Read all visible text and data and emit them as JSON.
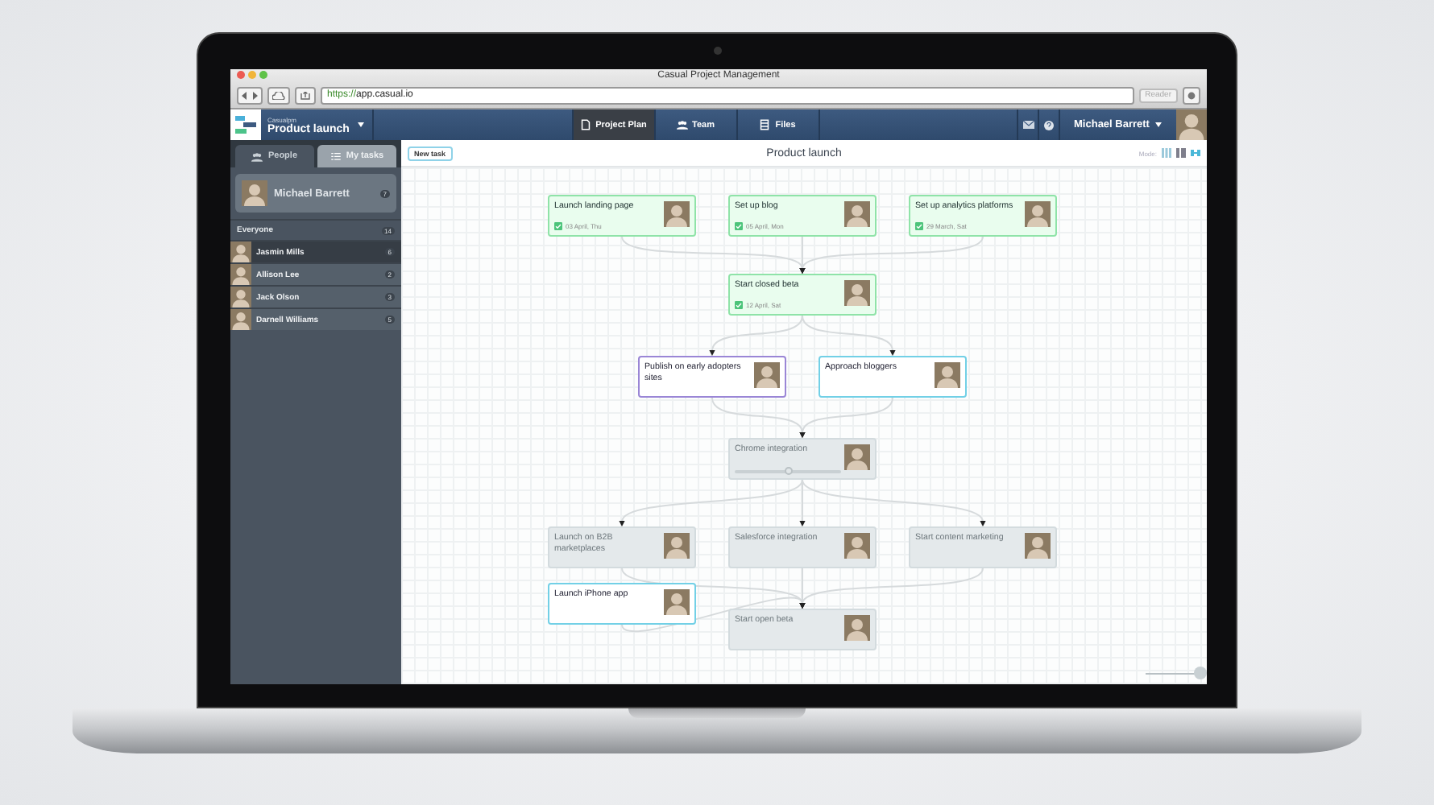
{
  "browser": {
    "title": "Casual Project Management",
    "url_scheme": "https://",
    "url_host": "app.casual.io",
    "reader": "Reader"
  },
  "app_nav": {
    "brand": "Casualpm",
    "project": "Product launch",
    "tabs": [
      {
        "label": "Project Plan",
        "kind": "plan",
        "selected": true
      },
      {
        "label": "Team",
        "kind": "team",
        "selected": false
      },
      {
        "label": "Files",
        "kind": "files",
        "selected": false
      }
    ],
    "user": "Michael Barrett"
  },
  "sidebar": {
    "tabs": [
      {
        "label": "People",
        "kind": "people",
        "selected": true
      },
      {
        "label": "My tasks",
        "kind": "list",
        "selected": false
      }
    ],
    "me": {
      "name": "Michael Barrett",
      "count": "7"
    },
    "everyone": {
      "label": "Everyone",
      "count": "14"
    },
    "people": [
      {
        "name": "Jasmin Mills",
        "count": "6",
        "selected": true
      },
      {
        "name": "Allison Lee",
        "count": "2",
        "selected": false
      },
      {
        "name": "Jack Olson",
        "count": "3",
        "selected": false
      },
      {
        "name": "Darnell Williams",
        "count": "5",
        "selected": false
      }
    ]
  },
  "toolbar": {
    "new_task": "New task",
    "title": "Product launch",
    "mode_label": "Mode:",
    "modes": [
      {
        "kind": "columns",
        "selected": false
      },
      {
        "kind": "rows",
        "selected": false
      },
      {
        "kind": "map",
        "selected": true
      }
    ]
  },
  "tasks": [
    {
      "title": "Launch landing page",
      "date": "03 April, Thu",
      "kind": "done",
      "color": "#8fe3a8"
    },
    {
      "title": "Set up blog",
      "date": "05 April, Mon",
      "kind": "done",
      "color": "#8fe3a8"
    },
    {
      "title": "Set up analytics platforms",
      "date": "29 March, Sat",
      "kind": "done",
      "color": "#8fe3a8"
    },
    {
      "title": "Start closed beta",
      "date": "12 April, Sat",
      "kind": "done",
      "color": "#8fe3a8"
    },
    {
      "title": "Publish on early adopters sites",
      "kind": "open",
      "color": "#9a86d6"
    },
    {
      "title": "Approach bloggers",
      "kind": "open",
      "color": "#72d0e6"
    },
    {
      "title": "Chrome integration",
      "kind": "blocked",
      "color": "#d3dbde",
      "level": 0.5
    },
    {
      "title": "Launch on B2B marketplaces",
      "kind": "blocked",
      "color": "#d3dbde"
    },
    {
      "title": "Salesforce integration",
      "kind": "blocked",
      "color": "#d3dbde"
    },
    {
      "title": "Start content marketing",
      "kind": "blocked",
      "color": "#d3dbde"
    },
    {
      "title": "Launch iPhone app",
      "kind": "open",
      "color": "#72d0e6"
    },
    {
      "title": "Start open beta",
      "kind": "blocked",
      "color": "#d3dbde"
    }
  ],
  "zoom": {
    "level": 1
  }
}
